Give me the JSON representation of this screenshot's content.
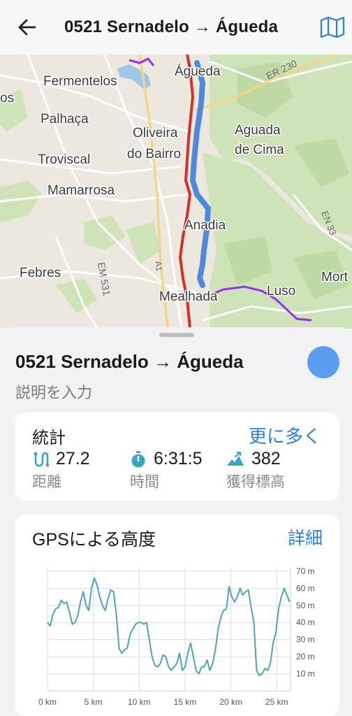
{
  "header": {
    "title": "0521 Sernadelo → Águeda",
    "back_icon": "arrow-left-icon",
    "map_icon": "map-icon"
  },
  "map": {
    "places": [
      {
        "key": "agueda",
        "label": "Águeda"
      },
      {
        "key": "fermentelos",
        "label": "Fermentelos"
      },
      {
        "key": "os",
        "label": "os"
      },
      {
        "key": "palhaca",
        "label": "Palhaça"
      },
      {
        "key": "oliveira1",
        "label": "Oliveira"
      },
      {
        "key": "oliveira2",
        "label": "do Bairro"
      },
      {
        "key": "aguada1",
        "label": "Aguada"
      },
      {
        "key": "aguada2",
        "label": "de Cima"
      },
      {
        "key": "troviscal",
        "label": "Troviscal"
      },
      {
        "key": "mamarrosa",
        "label": "Mamarrosa"
      },
      {
        "key": "anadia",
        "label": "Anadia"
      },
      {
        "key": "febres",
        "label": "Febres"
      },
      {
        "key": "mealhada",
        "label": "Mealhada"
      },
      {
        "key": "luso",
        "label": "Luso"
      },
      {
        "key": "mort",
        "label": "Mort"
      }
    ],
    "roads": {
      "er230": "ER 230",
      "en33": "EN 33",
      "a1": "A1",
      "em531": "EM 531"
    },
    "colors": {
      "track": "#3d7fd6",
      "red_route": "#d4302a",
      "purple_route": "#9333ea",
      "forest": "#cfe3b8"
    }
  },
  "sheet": {
    "title": "0521 Sernadelo → Águeda",
    "description_placeholder": "説明を入力",
    "track_color": "#5b9df0"
  },
  "stats": {
    "heading": "統計",
    "more_label": "更に多く",
    "distance": {
      "value": "27.2",
      "label": "距離",
      "icon": "distance-icon"
    },
    "time": {
      "value": "6:31:5",
      "label": "時間",
      "icon": "stopwatch-icon"
    },
    "ascent": {
      "value": "382",
      "label": "獲得標高",
      "icon": "ascent-icon"
    }
  },
  "elevation": {
    "heading": "GPSによる高度",
    "detail_label": "詳細"
  },
  "chart_data": {
    "type": "line",
    "title": "GPSによる高度",
    "x_tick_labels": [
      "0 km",
      "5 km",
      "10 km",
      "15 km",
      "20 km",
      "25 km"
    ],
    "y_tick_labels": [
      "10 m",
      "20 m",
      "30 m",
      "40 m",
      "50 m",
      "60 m",
      "70 m"
    ],
    "xlim": [
      0,
      26.5
    ],
    "ylim": [
      0,
      72
    ],
    "grid": true,
    "line_color": "#4fa3b8",
    "series": [
      {
        "x": [
          0,
          0.3,
          0.6,
          0.9,
          1.2,
          1.5,
          1.8,
          2.1,
          2.4,
          2.7,
          3.0,
          3.3,
          3.6,
          3.9,
          4.2,
          4.5,
          4.8,
          5.1,
          5.4,
          5.7,
          6.0,
          6.3,
          6.6,
          6.9,
          7.2,
          7.5,
          7.8,
          8.1,
          8.4,
          8.7,
          9.0,
          9.3,
          9.6,
          9.9,
          10.2,
          10.5,
          10.8,
          11.1,
          11.4,
          11.7,
          12.0,
          12.3,
          12.6,
          12.9,
          13.2,
          13.5,
          13.8,
          14.1,
          14.4,
          14.7,
          15.0,
          15.3,
          15.6,
          15.9,
          16.2,
          16.5,
          16.8,
          17.1,
          17.4,
          17.7,
          18.0,
          18.3,
          18.6,
          18.9,
          19.2,
          19.5,
          19.8,
          20.1,
          20.4,
          20.7,
          21.0,
          21.3,
          21.6,
          21.9,
          22.2,
          22.5,
          22.8,
          23.1,
          23.4,
          23.7,
          24.0,
          24.3,
          24.6,
          24.9,
          25.2,
          25.5,
          25.8,
          26.1,
          26.4
        ],
        "y": [
          40,
          38,
          45,
          48,
          49,
          53,
          51,
          52,
          46,
          39,
          40,
          44,
          52,
          58,
          50,
          47,
          60,
          66,
          62,
          55,
          50,
          47,
          54,
          59,
          58,
          45,
          25,
          22,
          24,
          25,
          33,
          36,
          39,
          40,
          40,
          39,
          40,
          30,
          20,
          15,
          14,
          16,
          21,
          20,
          14,
          12,
          14,
          16,
          22,
          12,
          14,
          22,
          28,
          20,
          12,
          10,
          14,
          14,
          18,
          12,
          16,
          24,
          36,
          43,
          47,
          48,
          61,
          55,
          52,
          55,
          60,
          56,
          58,
          59,
          49,
          40,
          12,
          9,
          10,
          13,
          12,
          16,
          28,
          34,
          48,
          55,
          60,
          56,
          52
        ]
      }
    ]
  }
}
